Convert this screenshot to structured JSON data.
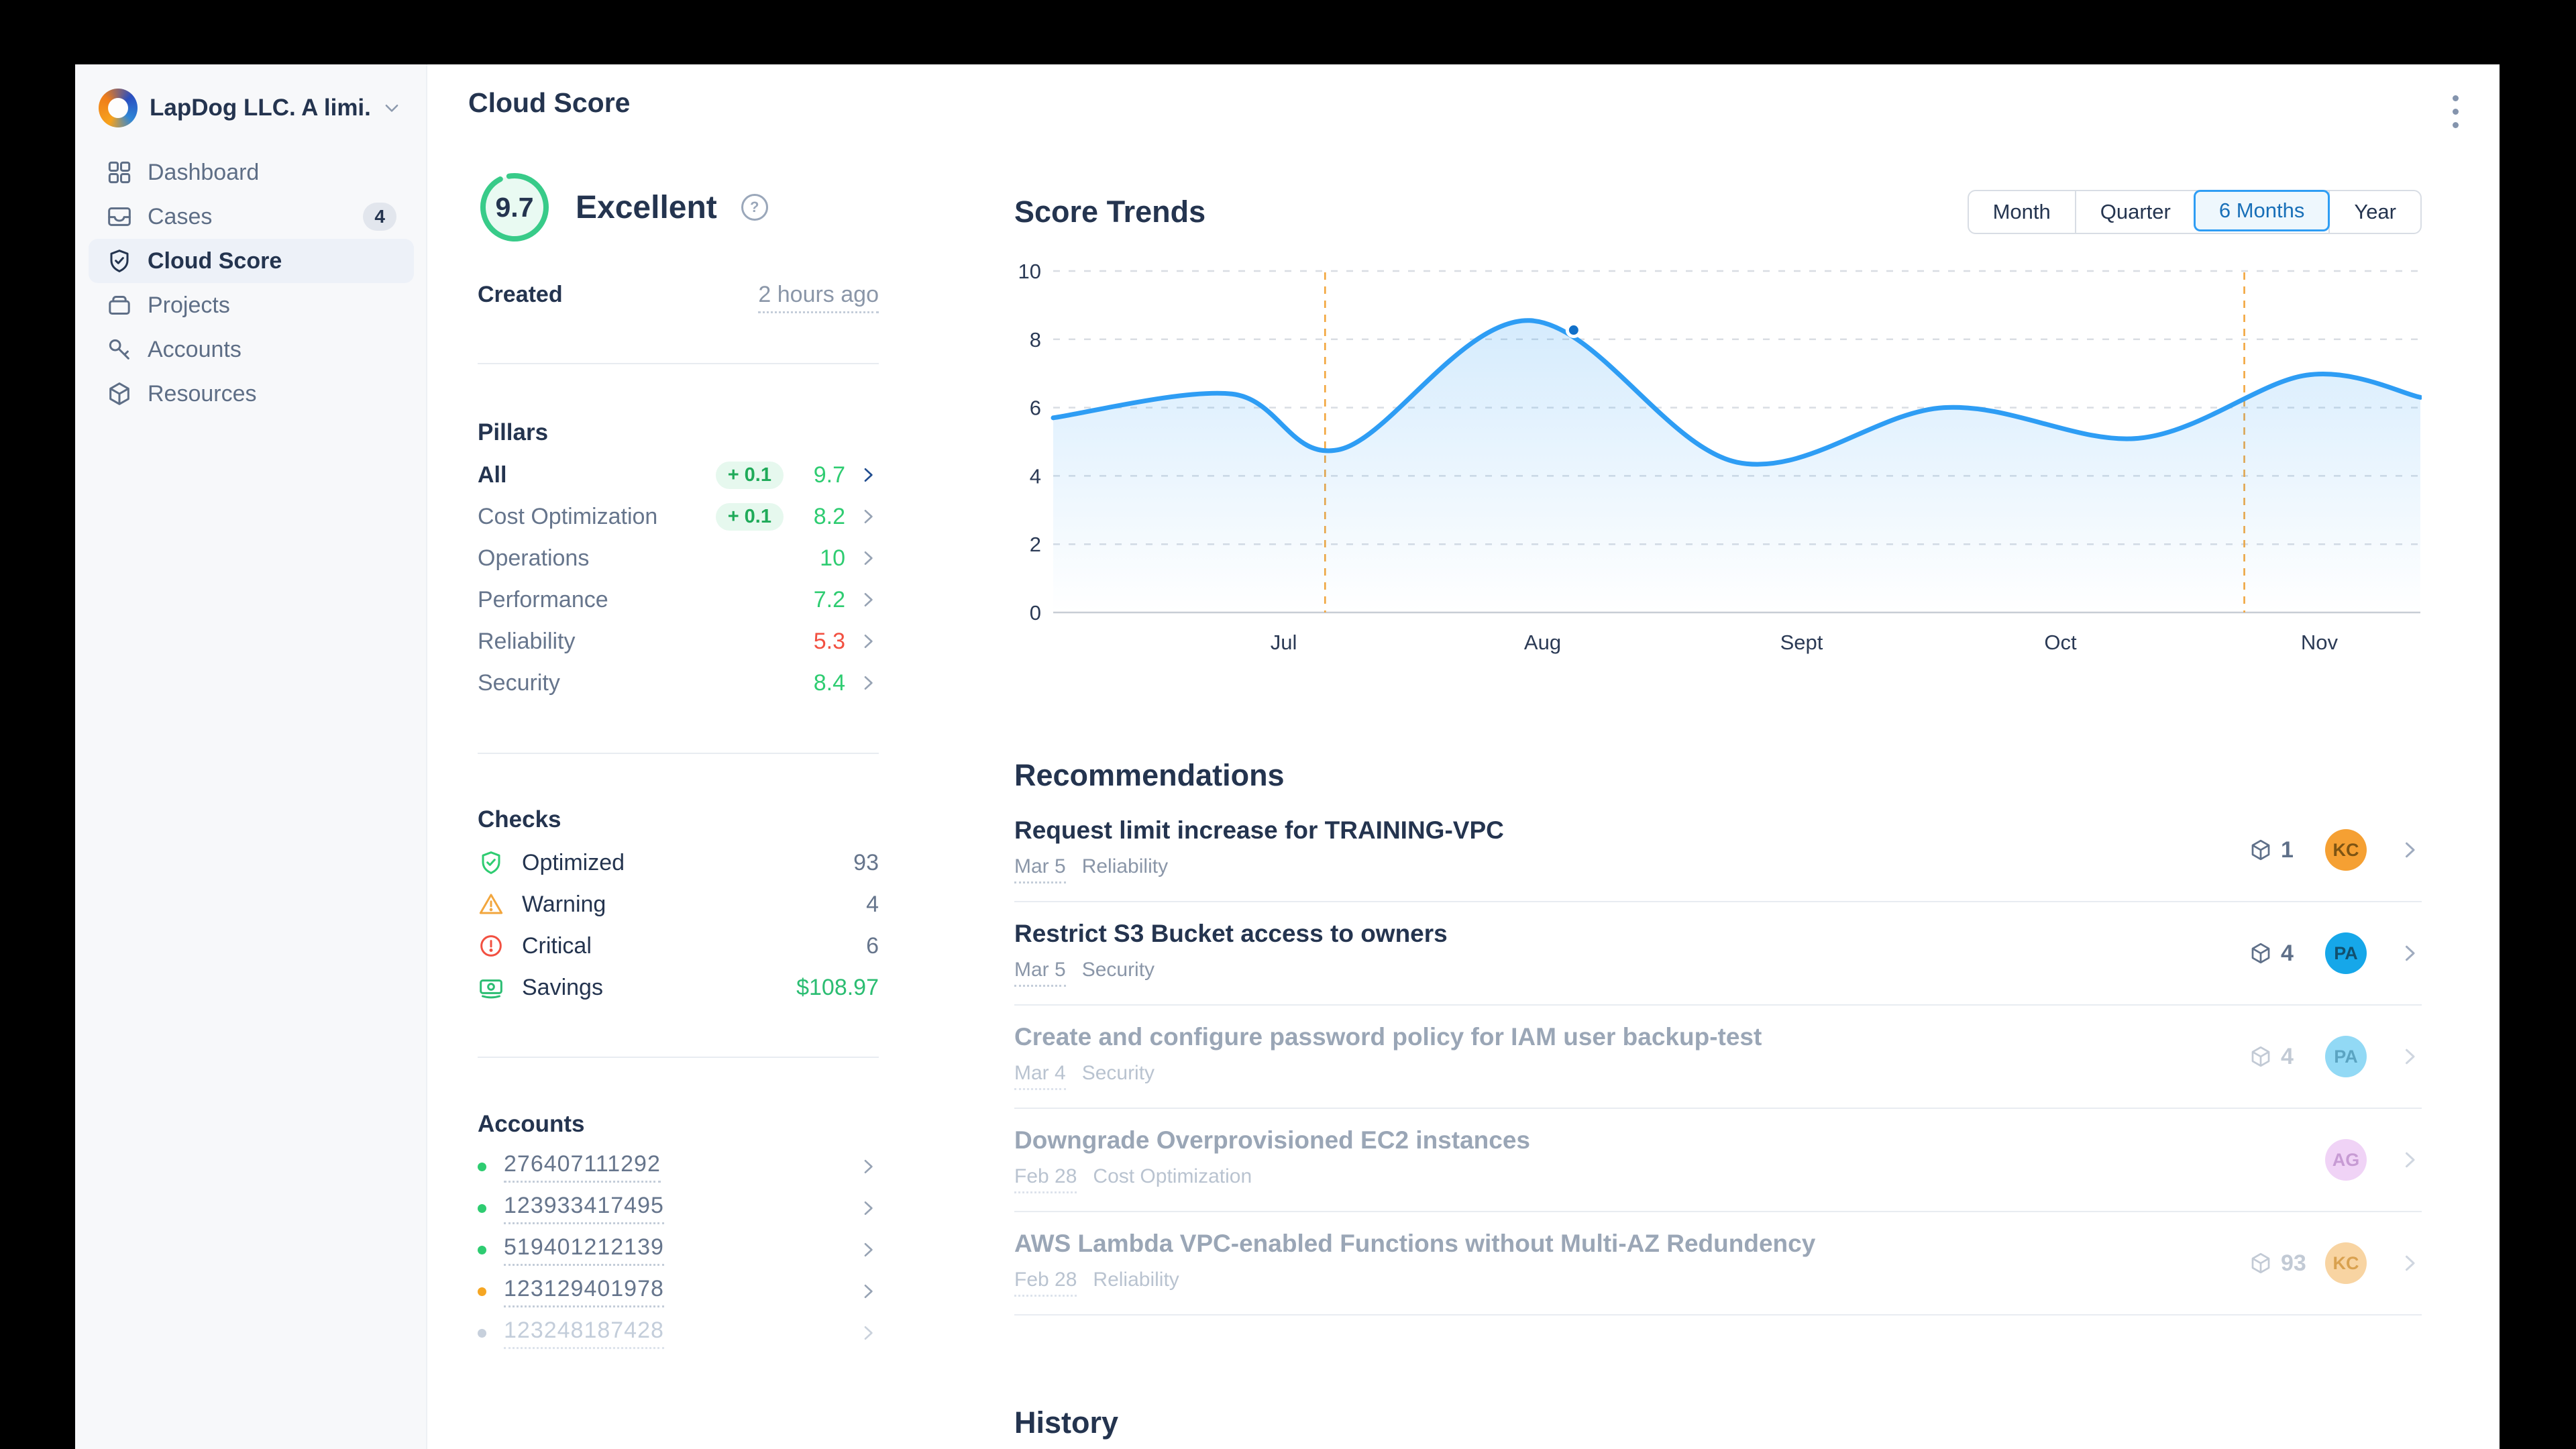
{
  "workspace": {
    "name": "LapDog LLC. A limi..."
  },
  "page": {
    "title": "Cloud Score"
  },
  "sidebar": {
    "items": [
      {
        "label": "Dashboard",
        "icon": "dashboard",
        "active": false
      },
      {
        "label": "Cases",
        "icon": "cases",
        "badge": "4",
        "active": false
      },
      {
        "label": "Cloud Score",
        "icon": "shield-check",
        "active": true
      },
      {
        "label": "Projects",
        "icon": "box",
        "active": false
      },
      {
        "label": "Accounts",
        "icon": "key",
        "active": false
      },
      {
        "label": "Resources",
        "icon": "cube",
        "active": false
      }
    ]
  },
  "summary": {
    "score": "9.7",
    "rating": "Excellent",
    "created_label": "Created",
    "created_value": "2 hours ago",
    "pillars": {
      "heading": "Pillars",
      "rows": [
        {
          "label": "All",
          "delta": "+ 0.1",
          "value": "9.7",
          "value_color": "#2ecc71",
          "emphasis": true
        },
        {
          "label": "Cost Optimization",
          "delta": "+ 0.1",
          "value": "8.2",
          "value_color": "#2ecc71"
        },
        {
          "label": "Operations",
          "value": "10",
          "value_color": "#2ecc71"
        },
        {
          "label": "Performance",
          "value": "7.2",
          "value_color": "#2ecc71"
        },
        {
          "label": "Reliability",
          "value": "5.3",
          "value_color": "#f25041"
        },
        {
          "label": "Security",
          "value": "8.4",
          "value_color": "#2ecc71"
        }
      ]
    },
    "checks": {
      "heading": "Checks",
      "rows": [
        {
          "label": "Optimized",
          "icon": "shield-check",
          "value": "93"
        },
        {
          "label": "Warning",
          "icon": "warning",
          "value": "4"
        },
        {
          "label": "Critical",
          "icon": "critical",
          "value": "6"
        },
        {
          "label": "Savings",
          "icon": "savings",
          "value": "$108.97",
          "value_color": "#2bbd72"
        }
      ]
    },
    "accounts": {
      "heading": "Accounts",
      "rows": [
        {
          "number": "276407111292",
          "status_color": "#2ecc71"
        },
        {
          "number": "123933417495",
          "status_color": "#2ecc71"
        },
        {
          "number": "519401212139",
          "status_color": "#2ecc71"
        },
        {
          "number": "123129401978",
          "status_color": "#f5a623"
        },
        {
          "number": "123248187428",
          "status_color": "#c7d0dc",
          "muted": true
        }
      ]
    }
  },
  "trends": {
    "title": "Score Trends",
    "tabs": [
      "Month",
      "Quarter",
      "6 Months",
      "Year"
    ],
    "active_tab": "6 Months"
  },
  "chart_data": {
    "type": "line",
    "title": "Score Trends",
    "x_axis": {
      "labels": [
        "Jul",
        "Aug",
        "Sept",
        "Oct",
        "Nov"
      ],
      "label_positions": [
        1,
        2,
        3,
        4,
        5
      ],
      "range": [
        0.11,
        5.39
      ]
    },
    "y_axis": {
      "ticks": [
        0,
        2,
        4,
        6,
        8,
        10
      ],
      "range": [
        0,
        10
      ]
    },
    "series": [
      {
        "name": "score",
        "points": [
          [
            0.11,
            5.7
          ],
          [
            0.8,
            6.4
          ],
          [
            1.22,
            4.78
          ],
          [
            1.95,
            8.55
          ],
          [
            2.75,
            4.4
          ],
          [
            3.55,
            6.0
          ],
          [
            4.3,
            5.1
          ],
          [
            4.95,
            6.95
          ],
          [
            5.39,
            6.3
          ]
        ]
      }
    ],
    "marker": {
      "x": 2.12,
      "y": 8.27
    },
    "annotations": {
      "vlines": [
        1.16,
        4.71
      ]
    },
    "grid": "dashed",
    "colors": {
      "line": "#2e9df4",
      "dot": "#1170c9",
      "grid": "#d9dde3",
      "axis": "#c8cdd5",
      "vline": "#f2a63e",
      "label": "#2b3a55",
      "area_top": "rgba(46,157,244,0.20)",
      "area_bottom": "rgba(46,157,244,0)"
    }
  },
  "recommendations": {
    "heading": "Recommendations",
    "rows": [
      {
        "title": "Request limit increase for TRAINING-VPC",
        "date": "Mar 5",
        "category": "Reliability",
        "resources": "1",
        "avatar": "KC",
        "avatar_bg": "#f5a033",
        "avatar_fg": "#7d5413",
        "muted": false
      },
      {
        "title": "Restrict S3 Bucket access to owners",
        "date": "Mar 5",
        "category": "Security",
        "resources": "4",
        "avatar": "PA",
        "avatar_bg": "#16a7e9",
        "avatar_fg": "#11506e",
        "muted": false
      },
      {
        "title": "Create and configure password policy for IAM user backup-test",
        "date": "Mar 4",
        "category": "Security",
        "resources": "4",
        "avatar": "PA",
        "avatar_bg": "#92d9f5",
        "avatar_fg": "#5ba4c2",
        "muted": true
      },
      {
        "title": "Downgrade Overprovisioned EC2 instances",
        "date": "Feb 28",
        "category": "Cost Optimization",
        "resources": "",
        "avatar": "AG",
        "avatar_bg": "#f0d3f6",
        "avatar_fg": "#c79bd4",
        "muted": true
      },
      {
        "title": "AWS Lambda VPC-enabled Functions without Multi-AZ Redundency",
        "date": "Feb 28",
        "category": "Reliability",
        "resources": "93",
        "avatar": "KC",
        "avatar_bg": "#f8d4a2",
        "avatar_fg": "#d9a14f",
        "muted": true
      }
    ]
  },
  "history": {
    "heading": "History"
  }
}
